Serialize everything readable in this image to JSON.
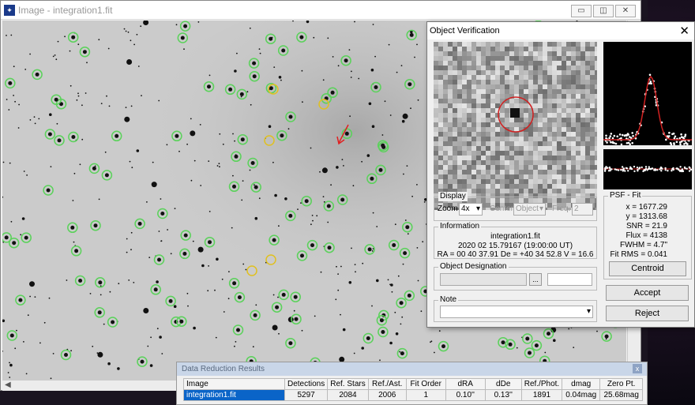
{
  "image_window": {
    "title": "Image - integration1.fit"
  },
  "object_verification": {
    "title": "Object Verification",
    "close": "✕",
    "display": {
      "label": "Display",
      "zoom_label": "Zoom",
      "zoom_value": "4x",
      "center_label": "Center",
      "center_value": "Object",
      "freq_label": "Freq.",
      "freq_value": "2"
    },
    "information": {
      "label": "Information",
      "file": "integration1.fit",
      "date": "2020 02 15.79167 (19:00:00 UT)",
      "coords": "RA = 00 40 37.91   De = +40 34 52.8   V = 16.6"
    },
    "designation": {
      "label": "Object Designation",
      "browse": "..."
    },
    "note": {
      "label": "Note"
    },
    "psf": {
      "label": "PSF - Fit",
      "x": "x = 1677.29",
      "y": "y = 1313.68",
      "snr": "SNR = 21.9",
      "flux": "Flux = 4138",
      "fwhm": "FWHM = 4.7\"",
      "fitrms": "Fit RMS = 0.041"
    },
    "buttons": {
      "centroid": "Centroid",
      "accept": "Accept",
      "reject": "Reject"
    }
  },
  "data_reduction": {
    "title": "Data Reduction Results",
    "close": "x",
    "columns": [
      "Image",
      "Detections",
      "Ref. Stars",
      "Ref./Ast.",
      "Fit Order",
      "dRA",
      "dDe",
      "Ref./Phot.",
      "dmag",
      "Zero Pt."
    ],
    "rows": [
      [
        "integration1.fit",
        "5297",
        "2084",
        "2006",
        "1",
        "0.10''",
        "0.13''",
        "1891",
        "0.04mag",
        "25.68mag"
      ]
    ]
  },
  "colors": {
    "green_circle": "#5ad25a",
    "yellow_circle": "#e0c020",
    "red_arrow": "#e02020",
    "selection": "#0a64c8"
  }
}
